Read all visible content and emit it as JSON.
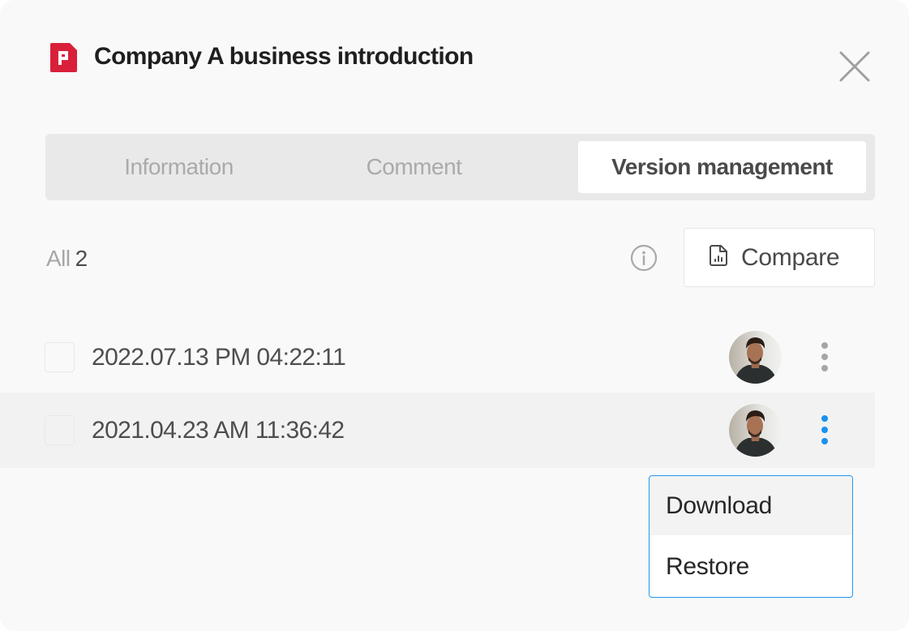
{
  "header": {
    "title": "Company A business introduction",
    "file_icon": "presentation-file-icon",
    "file_icon_color": "#d9203a",
    "close_icon": "close-icon"
  },
  "tabs": [
    {
      "label": "Information",
      "active": false
    },
    {
      "label": "Comment",
      "active": false
    },
    {
      "label": "Version management",
      "active": true
    }
  ],
  "toolbar": {
    "count_label": "All",
    "count_value": "2",
    "info_icon": "info-icon",
    "compare_label": "Compare",
    "compare_icon": "file-chart-icon"
  },
  "versions": [
    {
      "timestamp": "2022.07.13 PM 04:22:11",
      "checked": false,
      "avatar": "user-avatar",
      "menu_open": false
    },
    {
      "timestamp": "2021.04.23 AM 11:36:42",
      "checked": false,
      "avatar": "user-avatar",
      "menu_open": true
    }
  ],
  "context_menu": {
    "items": [
      {
        "label": "Download",
        "hovered": true
      },
      {
        "label": "Restore",
        "hovered": false
      }
    ]
  },
  "colors": {
    "accent": "#1a91f0",
    "menu_border": "#2196f3",
    "brand_red": "#d9203a",
    "panel_bg": "#f9f9f9",
    "tab_bg": "#e9e9e9"
  }
}
